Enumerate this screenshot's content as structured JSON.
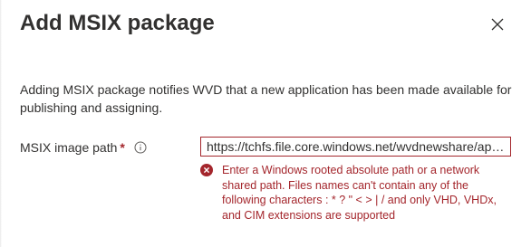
{
  "dialog": {
    "title": "Add MSIX package",
    "close_icon": "close-icon",
    "description": "Adding MSIX package notifies WVD that a new application has been made available for publishing and assigning."
  },
  "form": {
    "image_path": {
      "label": "MSIX image path",
      "required_marker": "*",
      "info_icon": "info-icon",
      "value": "https://tchfs.file.core.windows.net/wvdnewshare/appsh...",
      "error_icon": "error-circle-icon",
      "error_message": "Enter a Windows rooted absolute path or a network shared path. Files names can't contain any of the following characters : * ? \" < > | / and only VHD, VHDx, and CIM extensions are supported"
    }
  },
  "colors": {
    "text": "#323130",
    "error": "#a4262c",
    "border": "#a4262c"
  }
}
